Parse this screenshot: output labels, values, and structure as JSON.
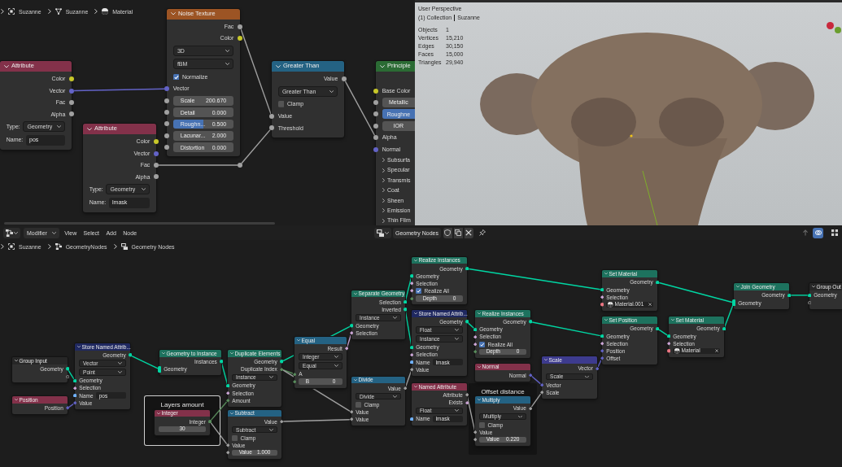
{
  "shader_editor": {
    "breadcrumb": [
      {
        "kind": "object",
        "label": "Suzanne"
      },
      {
        "kind": "mesh",
        "label": "Suzanne"
      },
      {
        "kind": "material",
        "label": "Material"
      }
    ],
    "nodes": [
      {
        "title": "Attribute",
        "kind": "input",
        "rows": [
          {
            "kind": "output",
            "label": "Color",
            "socket": {
              "kind": "color"
            }
          },
          {
            "kind": "output",
            "label": "Vector",
            "socket": {
              "kind": "vector"
            }
          },
          {
            "kind": "output",
            "label": "Fac",
            "socket": {
              "kind": "float"
            }
          },
          {
            "kind": "output",
            "label": "Alpha",
            "socket": {
              "kind": "float"
            }
          },
          {
            "kind": "labeled_dropdown",
            "label": "Type:",
            "value": "Geometry"
          },
          {
            "kind": "labeled_text",
            "label": "Name:",
            "value": "pos"
          }
        ]
      },
      {
        "title": "Attribute",
        "kind": "input",
        "rows": [
          {
            "kind": "output",
            "label": "Color",
            "socket": {
              "kind": "color"
            }
          },
          {
            "kind": "output",
            "label": "Vector",
            "socket": {
              "kind": "vector"
            }
          },
          {
            "kind": "output",
            "label": "Fac",
            "socket": {
              "kind": "float"
            }
          },
          {
            "kind": "output",
            "label": "Alpha",
            "socket": {
              "kind": "float"
            }
          },
          {
            "kind": "labeled_dropdown",
            "label": "Type:",
            "value": "Geometry"
          },
          {
            "kind": "labeled_text",
            "label": "Name:",
            "value": "lmask"
          }
        ]
      },
      {
        "title": "Noise Texture",
        "kind": "texture",
        "rows": [
          {
            "kind": "output",
            "label": "Fac",
            "socket": {
              "kind": "float"
            }
          },
          {
            "kind": "output",
            "label": "Color",
            "socket": {
              "kind": "color"
            }
          },
          {
            "kind": "dropdown",
            "value": "3D"
          },
          {
            "kind": "dropdown",
            "value": "fBM"
          },
          {
            "kind": "checkbox",
            "label": "Normalize",
            "checked": true
          },
          {
            "kind": "input",
            "label": "Vector",
            "socket": {
              "kind": "vector"
            }
          },
          {
            "kind": "number",
            "label": "Scale",
            "value": "200.670",
            "socket": {
              "kind": "float"
            }
          },
          {
            "kind": "number",
            "label": "Detail",
            "value": "0.000",
            "socket": {
              "kind": "float"
            }
          },
          {
            "kind": "number",
            "label": "Roughn...",
            "value": "0.500",
            "socket": {
              "kind": "float"
            },
            "level": 0.5
          },
          {
            "kind": "number",
            "label": "Lacunar...",
            "value": "2.000",
            "socket": {
              "kind": "float"
            }
          },
          {
            "kind": "number",
            "label": "Distortion",
            "value": "0.000",
            "socket": {
              "kind": "float"
            }
          }
        ]
      },
      {
        "title": "Greater Than",
        "kind": "converter",
        "rows": [
          {
            "kind": "output",
            "label": "Value",
            "socket": {
              "kind": "float"
            }
          },
          {
            "kind": "dropdown",
            "value": "Greater Than"
          },
          {
            "kind": "checkbox",
            "label": "Clamp",
            "checked": false
          },
          {
            "kind": "input",
            "label": "Value",
            "socket": {
              "kind": "float"
            }
          },
          {
            "kind": "input",
            "label": "Threshold",
            "socket": {
              "kind": "float"
            }
          }
        ]
      },
      {
        "title": "Principle",
        "kind": "shader",
        "rows": [
          {
            "kind": "input",
            "label": "Base Color",
            "socket": {
              "kind": "color"
            }
          },
          {
            "kind": "number",
            "label": "Metallic",
            "socket": {
              "kind": "float"
            }
          },
          {
            "kind": "number",
            "label": "Roughne",
            "socket": {
              "kind": "float"
            },
            "level": 1
          },
          {
            "kind": "number",
            "label": "IOR",
            "socket": {
              "kind": "float"
            }
          },
          {
            "kind": "input",
            "label": "Alpha",
            "socket": {
              "kind": "float"
            }
          },
          {
            "kind": "input",
            "label": "Normal",
            "socket": {
              "kind": "vector"
            }
          },
          {
            "kind": "panel",
            "label": "Subsurfa"
          },
          {
            "kind": "panel",
            "label": "Specular"
          },
          {
            "kind": "panel",
            "label": "Transmis"
          },
          {
            "kind": "panel",
            "label": "Coat"
          },
          {
            "kind": "panel",
            "label": "Sheen"
          },
          {
            "kind": "panel",
            "label": "Emission"
          },
          {
            "kind": "panel",
            "label": "Thin Film"
          }
        ]
      }
    ]
  },
  "viewport": {
    "view": "User Perspective",
    "collection": "(1) Collection",
    "object": "Suzanne",
    "stats": [
      {
        "label": "Objects",
        "value": "1"
      },
      {
        "label": "Vertices",
        "value": "15,210"
      },
      {
        "label": "Edges",
        "value": "30,150"
      },
      {
        "label": "Faces",
        "value": "15,000"
      },
      {
        "label": "Triangles",
        "value": "29,940"
      }
    ]
  },
  "geometry_editor": {
    "header": {
      "mode": "Modifier",
      "menus": [
        "View",
        "Select",
        "Add",
        "Node"
      ],
      "node_tree": "Geometry Nodes",
      "overlay": {
        "on": true
      }
    },
    "breadcrumb": [
      {
        "kind": "object",
        "label": "Suzanne"
      },
      {
        "kind": "modifier",
        "label": "GeometryNodes"
      },
      {
        "kind": "node_tree",
        "label": "Geometry Nodes"
      }
    ],
    "frames": [
      {
        "label": "Layers amount",
        "selected": true
      },
      {
        "label": "Offset distance",
        "selected": false
      }
    ],
    "nodes": [
      {
        "title": "Group Input",
        "kind": "group",
        "rows": [
          {
            "kind": "output",
            "label": "Geometry",
            "socket": {
              "kind": "geometry"
            }
          },
          {
            "kind": "output",
            "socket": {
              "kind": "empty"
            }
          }
        ]
      },
      {
        "title": "Position",
        "kind": "input",
        "rows": [
          {
            "kind": "output",
            "label": "Position",
            "socket": {
              "kind": "vector_field"
            }
          }
        ]
      },
      {
        "title": "Store Named Attrib...",
        "kind": "attribute",
        "rows": [
          {
            "kind": "output",
            "label": "Geometry",
            "socket": {
              "kind": "geometry"
            }
          },
          {
            "kind": "dropdown",
            "value": "Vector"
          },
          {
            "kind": "dropdown",
            "value": "Point"
          },
          {
            "kind": "input",
            "label": "Geometry",
            "socket": {
              "kind": "geometry"
            }
          },
          {
            "kind": "input",
            "label": "Selection",
            "socket": {
              "kind": "bool_field"
            }
          },
          {
            "kind": "text_input",
            "label": "Name",
            "value": "pos",
            "socket": {
              "kind": "string"
            }
          },
          {
            "kind": "input",
            "label": "Value",
            "socket": {
              "kind": "vector_field"
            }
          }
        ]
      },
      {
        "title": "Geometry to Instance",
        "kind": "geometry",
        "rows": [
          {
            "kind": "output",
            "label": "Instances",
            "socket": {
              "kind": "geometry"
            }
          },
          {
            "kind": "input",
            "label": "Geometry",
            "socket": {
              "kind": "geometry_multi"
            }
          }
        ]
      },
      {
        "title": "Duplicate Elements",
        "kind": "geometry",
        "rows": [
          {
            "kind": "output",
            "label": "Geometry",
            "socket": {
              "kind": "geometry"
            }
          },
          {
            "kind": "output",
            "label": "Duplicate Index",
            "socket": {
              "kind": "int_field"
            }
          },
          {
            "kind": "dropdown",
            "value": "Instance"
          },
          {
            "kind": "input",
            "label": "Geometry",
            "socket": {
              "kind": "geometry"
            }
          },
          {
            "kind": "input",
            "label": "Selection",
            "socket": {
              "kind": "bool_field"
            }
          },
          {
            "kind": "input",
            "label": "Amount",
            "socket": {
              "kind": "int_field"
            }
          }
        ]
      },
      {
        "title": "Integer",
        "kind": "input",
        "rows": [
          {
            "kind": "output",
            "label": "Integer",
            "socket": {
              "kind": "int"
            }
          },
          {
            "kind": "number",
            "value": "30"
          }
        ]
      },
      {
        "title": "Subtract",
        "kind": "converter",
        "rows": [
          {
            "kind": "output",
            "label": "Value",
            "socket": {
              "kind": "float_field"
            }
          },
          {
            "kind": "dropdown",
            "value": "Subtract"
          },
          {
            "kind": "checkbox",
            "label": "Clamp",
            "checked": false
          },
          {
            "kind": "input",
            "label": "Value",
            "socket": {
              "kind": "float_field"
            }
          },
          {
            "kind": "number",
            "label": "Value",
            "value": "1.000",
            "socket": {
              "kind": "float_field"
            }
          }
        ]
      },
      {
        "title": "Equal",
        "kind": "converter",
        "rows": [
          {
            "kind": "output",
            "label": "Result",
            "socket": {
              "kind": "bool_field"
            }
          },
          {
            "kind": "dropdown",
            "value": "Integer"
          },
          {
            "kind": "dropdown",
            "value": "Equal"
          },
          {
            "kind": "input",
            "label": "A",
            "socket": {
              "kind": "int_field"
            }
          },
          {
            "kind": "number",
            "label": "B",
            "value": "0",
            "socket": {
              "kind": "int_field"
            }
          }
        ]
      },
      {
        "title": "Separate Geometry",
        "kind": "geometry",
        "rows": [
          {
            "kind": "output",
            "label": "Selection",
            "socket": {
              "kind": "geometry"
            }
          },
          {
            "kind": "output",
            "label": "Inverted",
            "socket": {
              "kind": "geometry"
            }
          },
          {
            "kind": "dropdown",
            "value": "Instance"
          },
          {
            "kind": "input",
            "label": "Geometry",
            "socket": {
              "kind": "geometry"
            }
          },
          {
            "kind": "input",
            "label": "Selection",
            "socket": {
              "kind": "bool_field"
            }
          }
        ]
      },
      {
        "title": "Divide",
        "kind": "converter",
        "rows": [
          {
            "kind": "output",
            "label": "Value",
            "socket": {
              "kind": "float_field"
            }
          },
          {
            "kind": "dropdown",
            "value": "Divide"
          },
          {
            "kind": "checkbox",
            "label": "Clamp",
            "checked": false
          },
          {
            "kind": "input",
            "label": "Value",
            "socket": {
              "kind": "float_field"
            }
          },
          {
            "kind": "input",
            "label": "Value",
            "socket": {
              "kind": "float_field"
            }
          }
        ]
      },
      {
        "title": "Realize Instances",
        "kind": "geometry",
        "rows": [
          {
            "kind": "output",
            "label": "Geometry",
            "socket": {
              "kind": "geometry"
            }
          },
          {
            "kind": "input",
            "label": "Geometry",
            "socket": {
              "kind": "geometry"
            }
          },
          {
            "kind": "input",
            "label": "Selection",
            "socket": {
              "kind": "bool_field"
            }
          },
          {
            "kind": "checkbox",
            "label": "Realize All",
            "checked": true,
            "socket": {
              "kind": "bool_field"
            }
          },
          {
            "kind": "number",
            "label": "Depth",
            "value": "0",
            "socket": {
              "kind": "int_field"
            }
          }
        ]
      },
      {
        "title": "Store Named Attrib...",
        "kind": "attribute",
        "rows": [
          {
            "kind": "output",
            "label": "Geometry",
            "socket": {
              "kind": "geometry"
            }
          },
          {
            "kind": "dropdown",
            "value": "Float"
          },
          {
            "kind": "dropdown",
            "value": "Instance"
          },
          {
            "kind": "input",
            "label": "Geometry",
            "socket": {
              "kind": "geometry"
            }
          },
          {
            "kind": "input",
            "label": "Selection",
            "socket": {
              "kind": "bool_field"
            }
          },
          {
            "kind": "text_input",
            "label": "Name",
            "value": "lmask",
            "socket": {
              "kind": "string"
            }
          },
          {
            "kind": "input",
            "label": "Value",
            "socket": {
              "kind": "float_field"
            }
          }
        ]
      },
      {
        "title": "Named Attribute",
        "kind": "input",
        "rows": [
          {
            "kind": "output",
            "label": "Attribute",
            "socket": {
              "kind": "float_field"
            }
          },
          {
            "kind": "output",
            "label": "Exists",
            "socket": {
              "kind": "bool_field"
            }
          },
          {
            "kind": "dropdown",
            "value": "Float"
          },
          {
            "kind": "text_input",
            "label": "Name",
            "value": "lmask",
            "socket": {
              "kind": "string"
            }
          }
        ]
      },
      {
        "title": "Realize Instances",
        "kind": "geometry",
        "rows": [
          {
            "kind": "output",
            "label": "Geometry",
            "socket": {
              "kind": "geometry"
            }
          },
          {
            "kind": "input",
            "label": "Geometry",
            "socket": {
              "kind": "geometry"
            }
          },
          {
            "kind": "input",
            "label": "Selection",
            "socket": {
              "kind": "bool_field"
            }
          },
          {
            "kind": "checkbox",
            "label": "Realize All",
            "checked": true,
            "socket": {
              "kind": "bool_field"
            }
          },
          {
            "kind": "number",
            "label": "Depth",
            "value": "0",
            "socket": {
              "kind": "int_field"
            }
          }
        ]
      },
      {
        "title": "Normal",
        "kind": "input",
        "rows": [
          {
            "kind": "output",
            "label": "Normal",
            "socket": {
              "kind": "vector_field"
            }
          }
        ]
      },
      {
        "title": "Multiply",
        "kind": "converter",
        "rows": [
          {
            "kind": "output",
            "label": "Value",
            "socket": {
              "kind": "float_field"
            }
          },
          {
            "kind": "dropdown",
            "value": "Multiply"
          },
          {
            "kind": "checkbox",
            "label": "Clamp",
            "checked": false
          },
          {
            "kind": "input",
            "label": "Value",
            "socket": {
              "kind": "float_field"
            }
          },
          {
            "kind": "number",
            "label": "Value",
            "value": "0.220",
            "socket": {
              "kind": "float_field"
            }
          }
        ]
      },
      {
        "title": "Scale",
        "kind": "vector",
        "rows": [
          {
            "kind": "output",
            "label": "Vector",
            "socket": {
              "kind": "vector_field"
            }
          },
          {
            "kind": "dropdown",
            "value": "Scale"
          },
          {
            "kind": "input",
            "label": "Vector",
            "socket": {
              "kind": "vector_field"
            }
          },
          {
            "kind": "input",
            "label": "Scale",
            "socket": {
              "kind": "float_field"
            }
          }
        ]
      },
      {
        "title": "Set Material",
        "kind": "geometry",
        "rows": [
          {
            "kind": "output",
            "label": "Geometry",
            "socket": {
              "kind": "geometry"
            }
          },
          {
            "kind": "input",
            "label": "Geometry",
            "socket": {
              "kind": "geometry"
            }
          },
          {
            "kind": "input",
            "label": "Selection",
            "socket": {
              "kind": "bool_field"
            }
          },
          {
            "kind": "material",
            "value": "Material.001",
            "socket": {
              "kind": "material"
            }
          }
        ]
      },
      {
        "title": "Set Position",
        "kind": "geometry",
        "rows": [
          {
            "kind": "output",
            "label": "Geometry",
            "socket": {
              "kind": "geometry"
            }
          },
          {
            "kind": "input",
            "label": "Geometry",
            "socket": {
              "kind": "geometry"
            }
          },
          {
            "kind": "input",
            "label": "Selection",
            "socket": {
              "kind": "bool_field"
            }
          },
          {
            "kind": "input",
            "label": "Position",
            "socket": {
              "kind": "vector_field"
            }
          },
          {
            "kind": "input",
            "label": "Offset",
            "socket": {
              "kind": "vector_field"
            }
          }
        ]
      },
      {
        "title": "Set Material",
        "kind": "geometry",
        "rows": [
          {
            "kind": "output",
            "label": "Geometry",
            "socket": {
              "kind": "geometry"
            }
          },
          {
            "kind": "input",
            "label": "Geometry",
            "socket": {
              "kind": "geometry"
            }
          },
          {
            "kind": "input",
            "label": "Selection",
            "socket": {
              "kind": "bool_field"
            }
          },
          {
            "kind": "material",
            "value": "Material",
            "socket": {
              "kind": "material"
            }
          }
        ]
      },
      {
        "title": "Join Geometry",
        "kind": "geometry",
        "rows": [
          {
            "kind": "output",
            "label": "Geometry",
            "socket": {
              "kind": "geometry"
            }
          },
          {
            "kind": "input",
            "label": "Geometry",
            "socket": {
              "kind": "geometry_multi"
            }
          }
        ]
      },
      {
        "title": "Group Out",
        "kind": "group",
        "rows": [
          {
            "kind": "input",
            "label": "Geometry",
            "socket": {
              "kind": "geometry"
            }
          },
          {
            "kind": "input",
            "socket": {
              "kind": "empty"
            }
          }
        ]
      }
    ]
  }
}
